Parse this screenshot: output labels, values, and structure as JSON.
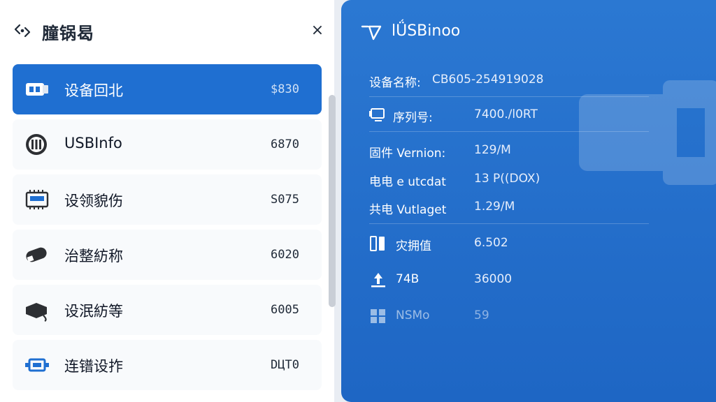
{
  "left": {
    "title": "膧锅曷",
    "close_icon": "×",
    "items": [
      {
        "icon": "usb-drive-icon",
        "label": "设备回北",
        "value": "$830",
        "active": true
      },
      {
        "icon": "usb-connector-icon",
        "label": "USBInfo",
        "value": "6870",
        "active": false
      },
      {
        "icon": "chip-icon",
        "label": "设领貌伤",
        "value": "S075",
        "active": false
      },
      {
        "icon": "flash-drive-icon",
        "label": "治整紡称",
        "value": "6020",
        "active": false
      },
      {
        "icon": "cable-icon",
        "label": "设泯紡等",
        "value": "6005",
        "active": false
      },
      {
        "icon": "port-icon",
        "label": "连镨设拃",
        "value": "DЦT0",
        "active": false
      }
    ]
  },
  "right": {
    "title": "lǗSBinoo",
    "rows": [
      {
        "label": "设备名称:",
        "value": "CB605-254919028"
      },
      {
        "label": "序列号:",
        "value": "7400./l0RT"
      },
      {
        "label": "固件 Vernion:",
        "value": "129/M"
      },
      {
        "label": "电电 e utcdat",
        "value": "13 P((DOX)"
      },
      {
        "label": "共电 Vutlaget",
        "value": "1.29/M"
      },
      {
        "label": "灾拥值",
        "value": "6.502"
      },
      {
        "label": "74B",
        "value": "36000"
      },
      {
        "label": "NSMo",
        "value": "59"
      }
    ]
  },
  "colors": {
    "accent": "#1f6fd1",
    "right_bg": "#2470cc",
    "text_dark": "#1f2937"
  }
}
